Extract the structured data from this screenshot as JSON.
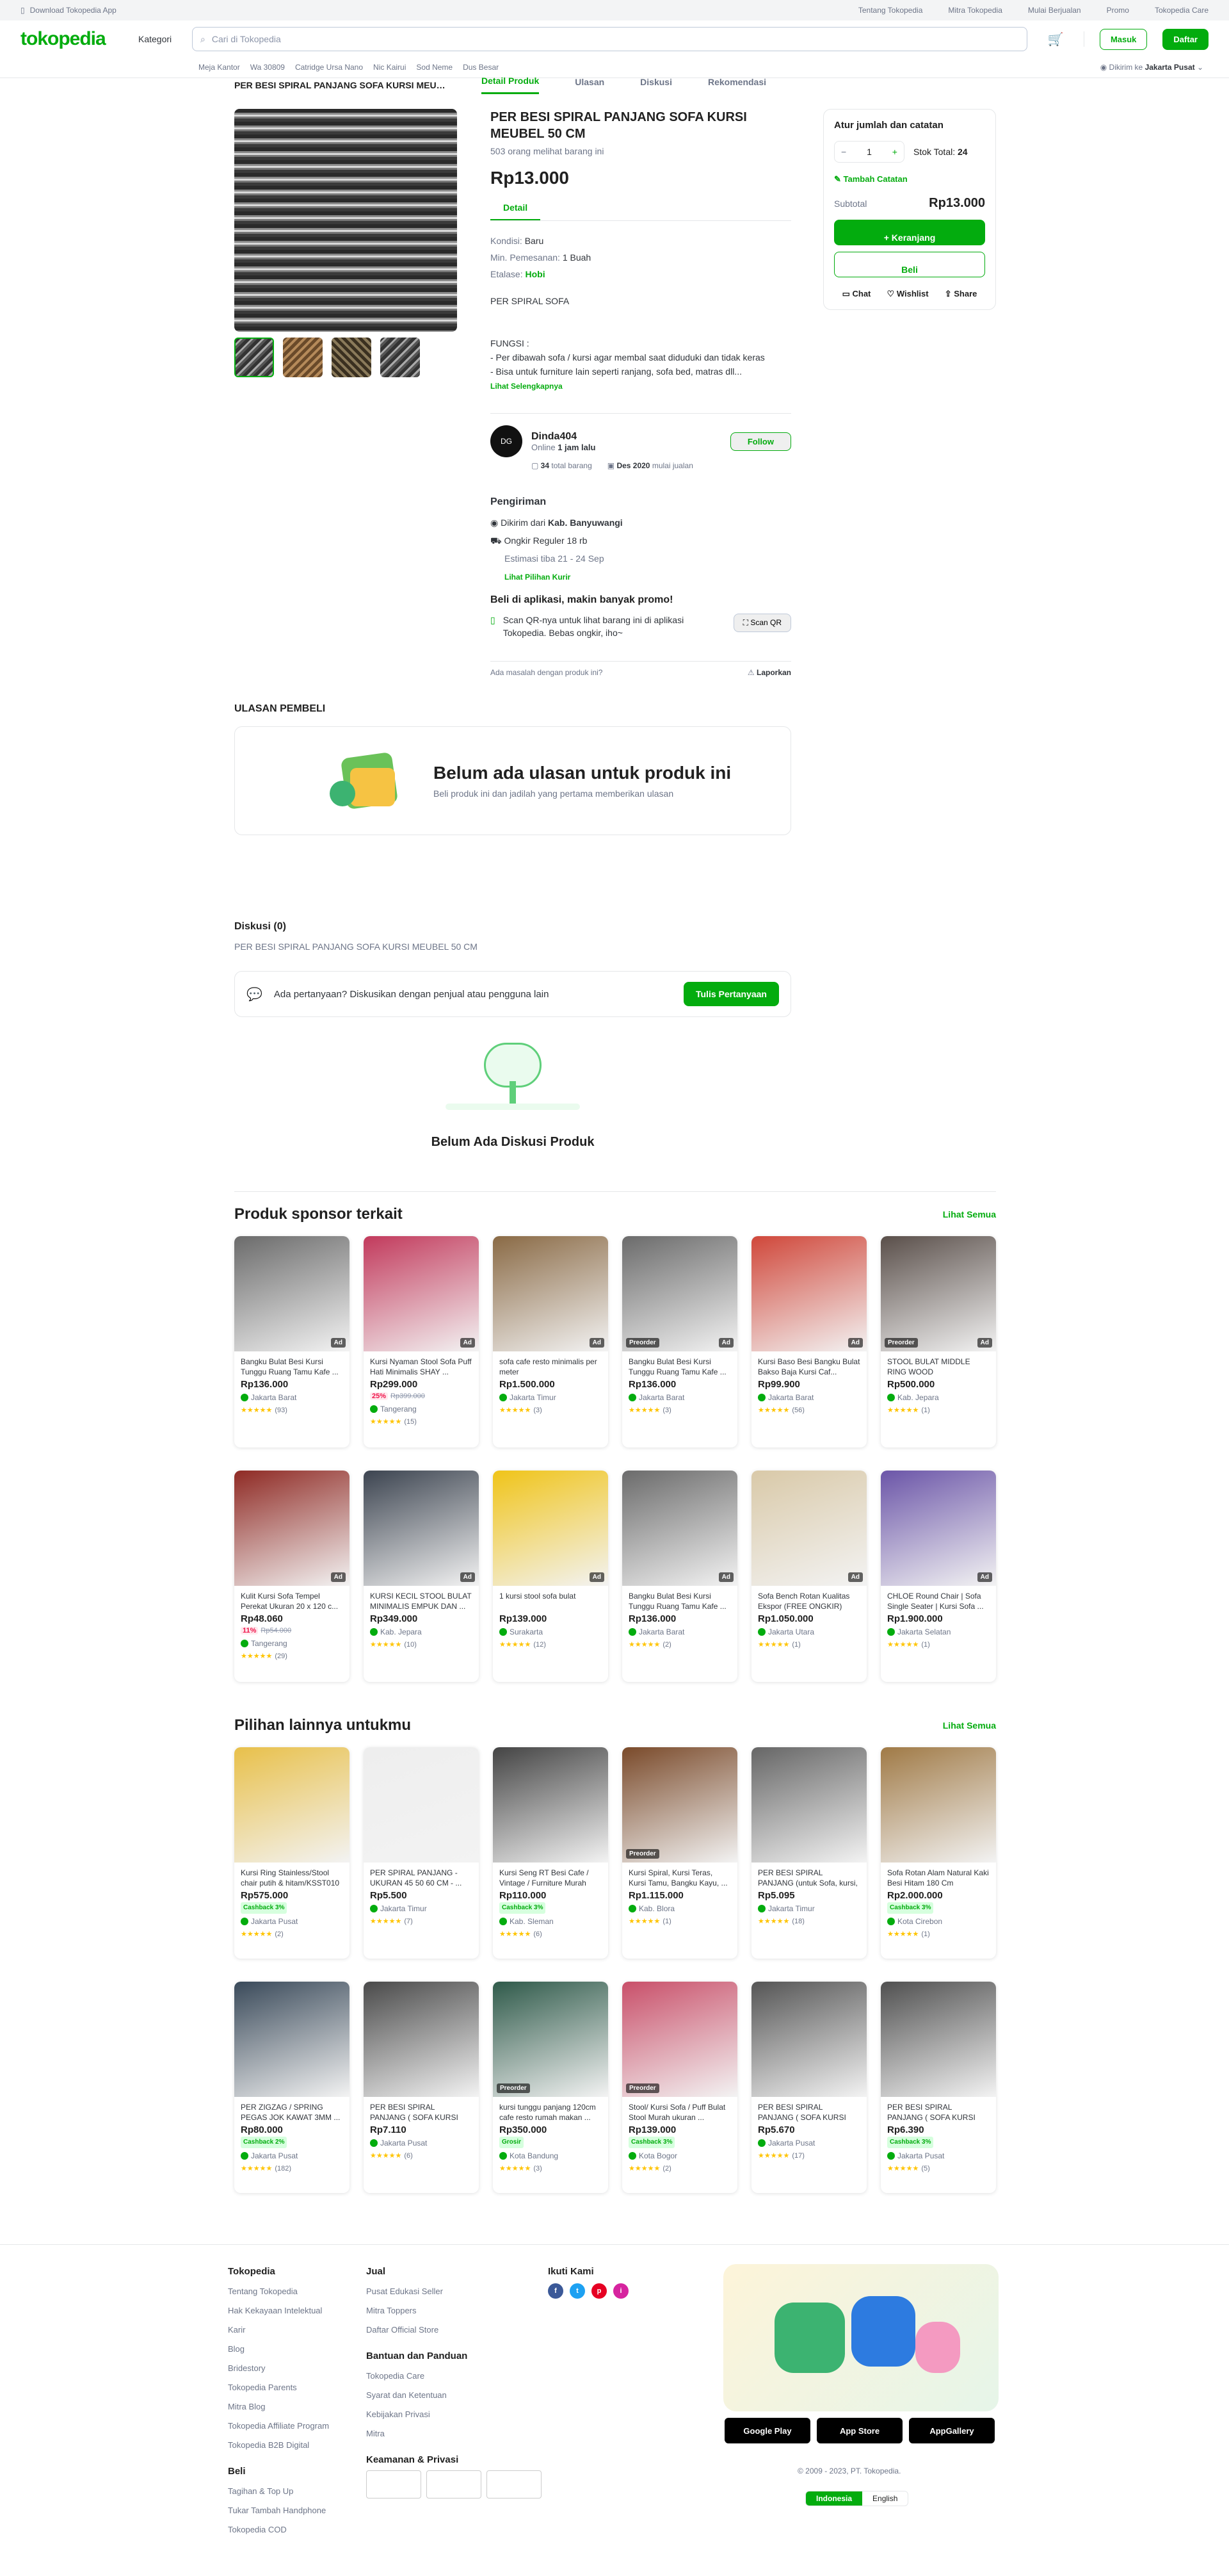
{
  "topbar": {
    "download": "Download Tokopedia App",
    "links": [
      "Tentang Tokopedia",
      "Mitra Tokopedia",
      "Mulai Berjualan",
      "Promo",
      "Tokopedia Care"
    ]
  },
  "header": {
    "logo": "tokopedia",
    "kategori": "Kategori",
    "search_placeholder": "Cari di Tokopedia",
    "masuk": "Masuk",
    "daftar": "Daftar",
    "keywords": [
      "Meja Kantor",
      "Wa 30809",
      "Catridge Ursa Nano",
      "Nic Kairui",
      "Sod Neme",
      "Dus Besar"
    ],
    "loc_prefix": "Dikirim ke",
    "loc_value": "Jakarta Pusat"
  },
  "subnav": {
    "title": "PER BESI SPIRAL PANJANG SOFA KURSI MEUBE...",
    "tabs": [
      "Detail Produk",
      "Ulasan",
      "Diskusi",
      "Rekomendasi"
    ]
  },
  "product": {
    "title": "PER BESI SPIRAL PANJANG SOFA KURSI MEUBEL 50 CM",
    "views": "503 orang melihat barang ini",
    "price": "Rp13.000",
    "detail_tab": "Detail",
    "kondisi_label": "Kondisi:",
    "kondisi": "Baru",
    "min_label": "Min. Pemesanan:",
    "min": "1 Buah",
    "etalase_label": "Etalase:",
    "etalase": "Hobi",
    "desc1": "PER SPIRAL SOFA",
    "desc2": "FUNGSI :",
    "desc3": "- Per dibawah sofa / kursi agar membal saat diduduki dan tidak keras",
    "desc4": "- Bisa untuk furniture lain seperti ranjang, sofa bed, matras dll...",
    "seemore": "Lihat Selengkapnya"
  },
  "seller": {
    "avatar": "DG",
    "name": "Dinda404",
    "online_prefix": "Online",
    "online": "1 jam lalu",
    "follow": "Follow",
    "items": "34",
    "items_label": "total barang",
    "since": "Des 2020",
    "since_label": "mulai jualan"
  },
  "shipping": {
    "title": "Pengiriman",
    "from_prefix": "Dikirim dari",
    "from": "Kab. Banyuwangi",
    "service": "Ongkir Reguler 18 rb",
    "eta": "Estimasi tiba 21 - 24 Sep",
    "courier": "Lihat Pilihan Kurir"
  },
  "app": {
    "title": "Beli di aplikasi, makin banyak promo!",
    "text": "Scan QR-nya untuk lihat barang ini di aplikasi Tokopedia. Bebas ongkir, iho~",
    "btn": "Scan QR"
  },
  "report": {
    "q": "Ada masalah dengan produk ini?",
    "btn": "Laporkan"
  },
  "buybox": {
    "title": "Atur jumlah dan catatan",
    "qty": "1",
    "stock_label": "Stok Total:",
    "stock": "24",
    "note": "Tambah Catatan",
    "subtotal_label": "Subtotal",
    "subtotal": "Rp13.000",
    "cart": "+ Keranjang",
    "buy": "Beli",
    "chat": "Chat",
    "wishlist": "Wishlist",
    "share": "Share"
  },
  "reviews": {
    "heading": "ULASAN PEMBELI",
    "empty_title": "Belum ada ulasan untuk produk ini",
    "empty_sub": "Beli produk ini dan jadilah yang pertama memberikan ulasan"
  },
  "discussion": {
    "heading": "Diskusi (0)",
    "sub": "PER BESI SPIRAL PANJANG SOFA KURSI MEUBEL 50 CM",
    "ask": "Ada pertanyaan? Diskusikan dengan penjual atau pengguna lain",
    "ask_btn": "Tulis Pertanyaan",
    "empty": "Belum Ada Diskusi Produk"
  },
  "sponsor": {
    "heading": "Produk sponsor terkait",
    "seeall": "Lihat Semua",
    "items": [
      {
        "name": "Bangku Bulat Besi Kursi Tunggu Ruang Tamu Kafe ...",
        "price": "Rp136.000",
        "loc": "Jakarta Barat",
        "rating": "(93)",
        "tag": "",
        "ad": "Ad",
        "color": "#6b6b6b"
      },
      {
        "name": "Kursi Nyaman Stool Sofa Puff Hati Minimalis SHAY ...",
        "price": "Rp299.000",
        "pct": "25%",
        "old": "Rp399.000",
        "loc": "Tangerang",
        "rating": "(15)",
        "tag": "",
        "ad": "Ad",
        "color": "#c23a5c"
      },
      {
        "name": "sofa cafe resto minimalis per meter",
        "price": "Rp1.500.000",
        "loc": "Jakarta Timur",
        "rating": "(3)",
        "tag": "",
        "ad": "Ad",
        "color": "#8a6a45"
      },
      {
        "name": "Bangku Bulat Besi Kursi Tunggu Ruang Tamu Kafe ...",
        "price": "Rp136.000",
        "loc": "Jakarta Barat",
        "rating": "(3)",
        "tag": "Preorder",
        "ad": "Ad",
        "color": "#6b6b6b"
      },
      {
        "name": "Kursi Baso Besi Bangku Bulat Bakso Baja Kursi Caf...",
        "price": "Rp99.900",
        "loc": "Jakarta Barat",
        "rating": "(56)",
        "tag": "",
        "ad": "Ad",
        "color": "#d0473a"
      },
      {
        "name": "STOOL BULAT MIDDLE RING WOOD",
        "price": "Rp500.000",
        "loc": "Kab. Jepara",
        "rating": "(1)",
        "tag": "Preorder",
        "ad": "Ad",
        "color": "#5a4f4a"
      },
      {
        "name": "Kulit Kursi Sofa Tempel Perekat Ukuran 20 x 120 c...",
        "price": "Rp48.060",
        "pct": "11%",
        "old": "Rp54.000",
        "loc": "Tangerang",
        "rating": "(29)",
        "tag": "",
        "ad": "Ad",
        "color": "#8f2a24"
      },
      {
        "name": "KURSI KECIL STOOL BULAT MINIMALIS EMPUK DAN ...",
        "price": "Rp349.000",
        "loc": "Kab. Jepara",
        "rating": "(10)",
        "tag": "",
        "ad": "Ad",
        "color": "#3c4450"
      },
      {
        "name": "1 kursi stool sofa bulat",
        "price": "Rp139.000",
        "loc": "Surakarta",
        "rating": "(12)",
        "tag": "",
        "ad": "Ad",
        "color": "#f0c419"
      },
      {
        "name": "Bangku Bulat Besi Kursi Tunggu Ruang Tamu Kafe ...",
        "price": "Rp136.000",
        "loc": "Jakarta Barat",
        "rating": "(2)",
        "tag": "",
        "ad": "Ad",
        "color": "#6b6b6b"
      },
      {
        "name": "Sofa Bench Rotan Kualitas Ekspor (FREE ONGKIR)",
        "price": "Rp1.050.000",
        "loc": "Jakarta Utara",
        "rating": "(1)",
        "tag": "",
        "ad": "Ad",
        "color": "#d9c9a8"
      },
      {
        "name": "CHLOE Round Chair | Sofa Single Seater | Kursi Sofa ...",
        "price": "Rp1.900.000",
        "loc": "Jakarta Selatan",
        "rating": "(1)",
        "tag": "",
        "ad": "Ad",
        "color": "#6b55a8"
      }
    ]
  },
  "others": {
    "heading": "Pilihan lainnya untukmu",
    "seeall": "Lihat Semua",
    "items": [
      {
        "name": "Kursi Ring Stainless/Stool chair putih & hitam/KSST010",
        "price": "Rp575.000",
        "cb": "Cashback 3%",
        "loc": "Jakarta Pusat",
        "rating": "(2)",
        "tag": "",
        "color": "#e8c04a"
      },
      {
        "name": "PER SPIRAL PANJANG - UKURAN 45 50 60 CM - ...",
        "price": "Rp5.500",
        "cb": "",
        "loc": "Jakarta Timur",
        "rating": "(7)",
        "tag": "",
        "color": "#eeeeee"
      },
      {
        "name": "Kursi Seng RT Besi Cafe / Vintage / Furniture Murah",
        "price": "Rp110.000",
        "cb": "Cashback 3%",
        "loc": "Kab. Sleman",
        "rating": "(6)",
        "tag": "",
        "color": "#444444"
      },
      {
        "name": "Kursi Spiral, Kursi Teras, Kursi Tamu, Bangku Kayu, ...",
        "price": "Rp1.115.000",
        "cb": "",
        "loc": "Kab. Blora",
        "rating": "(1)",
        "tag": "Preorder",
        "color": "#7a4a2a"
      },
      {
        "name": "PER BESI SPIRAL PANJANG (untuk Sofa, kursi, Jok) 45 ...",
        "price": "Rp5.095",
        "cb": "",
        "loc": "Jakarta Timur",
        "rating": "(18)",
        "tag": "",
        "color": "#666666"
      },
      {
        "name": "Sofa Rotan Alam Natural Kaki Besi Hitam 180 Cm",
        "price": "Rp2.000.000",
        "cb": "Cashback 3%",
        "loc": "Kota Cirebon",
        "rating": "(1)",
        "tag": "",
        "color": "#a07a46"
      },
      {
        "name": "PER ZIGZAG / SPRING PEGAS JOK KAWAT 3MM ...",
        "price": "Rp80.000",
        "cb": "Cashback 2%",
        "loc": "Jakarta Pusat",
        "rating": "(182)",
        "tag": "",
        "color": "#3a4a5a"
      },
      {
        "name": "PER BESI SPIRAL PANJANG ( SOFA KURSI MEUBEL ) 60 ...",
        "price": "Rp7.110",
        "cb": "",
        "loc": "Jakarta Pusat",
        "rating": "(6)",
        "tag": "",
        "color": "#4a4a4a"
      },
      {
        "name": "kursi tunggu panjang 120cm cafe resto rumah makan ...",
        "price": "Rp350.000",
        "cb": "Grosir",
        "loc": "Kota Bandung",
        "rating": "(3)",
        "tag": "Preorder",
        "color": "#2f5a4a"
      },
      {
        "name": "Stool/ Kursi Sofa / Puff Bulat Stool Murah ukuran ...",
        "price": "Rp139.000",
        "cb": "Cashback 3%",
        "loc": "Kota Bogor",
        "rating": "(2)",
        "tag": "Preorder",
        "color": "#c9506a"
      },
      {
        "name": "PER BESI SPIRAL PANJANG ( SOFA KURSI MEUBEL ) 50 ...",
        "price": "Rp5.670",
        "cb": "",
        "loc": "Jakarta Pusat",
        "rating": "(17)",
        "tag": "",
        "color": "#555555"
      },
      {
        "name": "PER BESI SPIRAL PANJANG ( SOFA KURSI MEUBEL ) 55 ...",
        "price": "Rp6.390",
        "cb": "Cashback 3%",
        "loc": "Jakarta Pusat",
        "rating": "(5)",
        "tag": "",
        "color": "#505050"
      }
    ]
  },
  "footer": {
    "tokopedia": {
      "title": "Tokopedia",
      "links": [
        "Tentang Tokopedia",
        "Hak Kekayaan Intelektual",
        "Karir",
        "Blog",
        "Bridestory",
        "Tokopedia Parents",
        "Mitra Blog",
        "Tokopedia Affiliate Program",
        "Tokopedia B2B Digital"
      ]
    },
    "beli": {
      "title": "Beli",
      "links": [
        "Tagihan & Top Up",
        "Tukar Tambah Handphone",
        "Tokopedia COD"
      ]
    },
    "jual": {
      "title": "Jual",
      "links": [
        "Pusat Edukasi Seller",
        "Mitra Toppers",
        "Daftar Official Store"
      ]
    },
    "bantuan": {
      "title": "Bantuan dan Panduan",
      "links": [
        "Tokopedia Care",
        "Syarat dan Ketentuan",
        "Kebijakan Privasi",
        "Mitra"
      ]
    },
    "keamanan": {
      "title": "Keamanan & Privasi"
    },
    "ikuti": {
      "title": "Ikuti Kami"
    },
    "stores": [
      "Google Play",
      "App Store",
      "AppGallery"
    ],
    "copyright": "© 2009 - 2023, PT. Tokopedia.",
    "lang": [
      "Indonesia",
      "English"
    ]
  }
}
